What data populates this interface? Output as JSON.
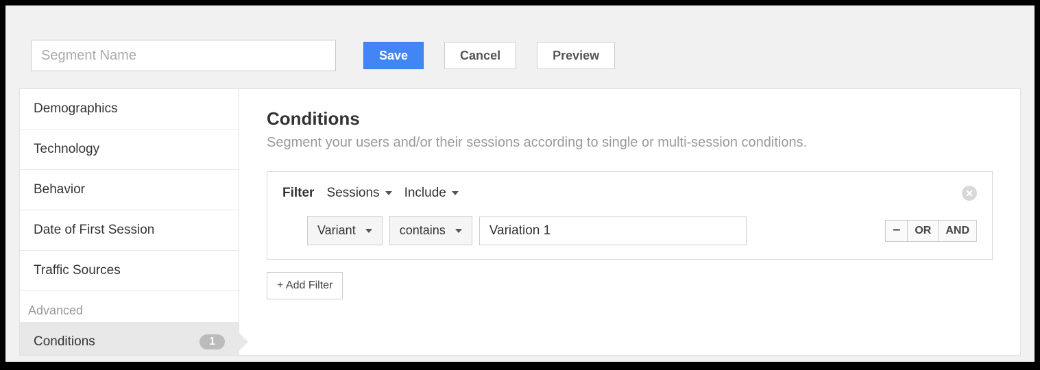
{
  "header": {
    "segment_name_placeholder": "Segment Name",
    "segment_name_value": "",
    "save_label": "Save",
    "cancel_label": "Cancel",
    "preview_label": "Preview"
  },
  "sidebar": {
    "items": [
      {
        "label": "Demographics"
      },
      {
        "label": "Technology"
      },
      {
        "label": "Behavior"
      },
      {
        "label": "Date of First Session"
      },
      {
        "label": "Traffic Sources"
      }
    ],
    "advanced_label": "Advanced",
    "active_item_label": "Conditions",
    "active_item_count": "1"
  },
  "panel": {
    "title": "Conditions",
    "description": "Segment your users and/or their sessions according to single or multi-session conditions.",
    "filter_label": "Filter",
    "scope_value": "Sessions",
    "include_value": "Include",
    "dimension_value": "Variant",
    "match_value": "contains",
    "input_value": "Variation 1",
    "remove_symbol": "–",
    "or_label": "OR",
    "and_label": "AND",
    "add_filter_label": "+ Add Filter"
  }
}
